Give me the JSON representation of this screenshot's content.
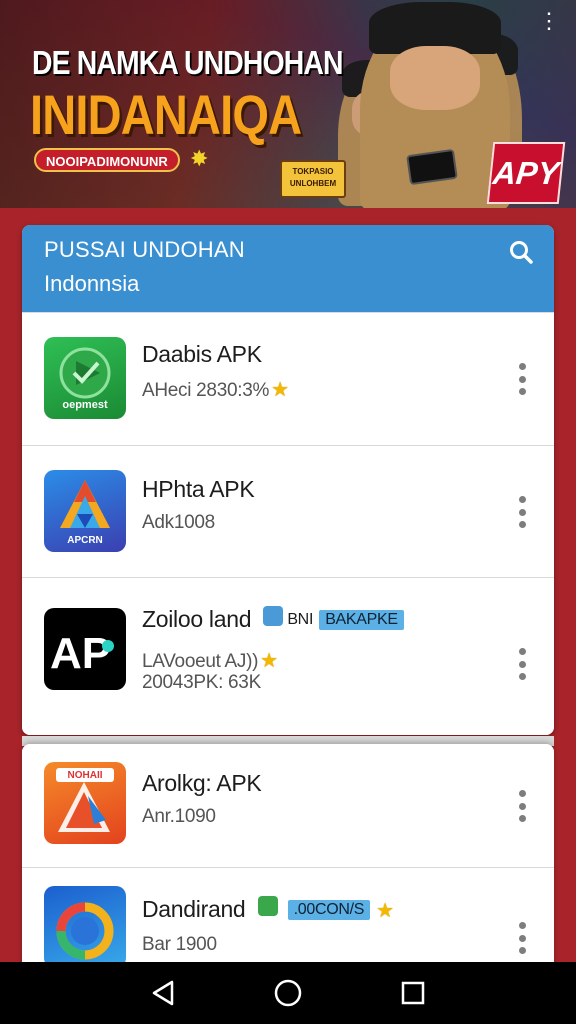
{
  "banner": {
    "line1": "DE NAMKA UNDHOHAN",
    "line2": "INIDANAIQA",
    "badge": "NOOIPADIMONUNR",
    "sign": "TOKPASIO UNLOHBEM",
    "apk_badge": "APY",
    "menu": "⋮"
  },
  "header": {
    "title": "PUSSAI UNDOHAN",
    "subtitle": "Indonnsia",
    "search_icon": "search-icon"
  },
  "apps": [
    {
      "name": "Daabis APK",
      "meta": "AHeci 2830:3%",
      "rating_star": true,
      "icon_label": "oepmest",
      "icon": "play-check-icon",
      "colors": [
        "#2db24a",
        "#1f8a36"
      ]
    },
    {
      "name": "HPhta APK",
      "meta": "Adk1008",
      "rating_star": false,
      "icon_label": "APCRN",
      "icon": "triangle-a-icon",
      "colors": [
        "#1e6fd9",
        "#2f4ab5"
      ]
    },
    {
      "name": "Zoiloo land",
      "tag": "BAKAPKE",
      "tag_prefix": "BNI",
      "meta": "LAVooeut AJ))",
      "meta2": "20043PK: 63K",
      "rating_star": true,
      "icon_label": "AP",
      "icon": "ap-logo-icon",
      "colors": [
        "#000000",
        "#111111"
      ]
    },
    {
      "name": "Arolkg: APK",
      "meta": "Anr.1090",
      "rating_star": false,
      "icon_label": "NOHAII",
      "icon": "orange-a-icon",
      "colors": [
        "#f07a22",
        "#e2431f"
      ]
    },
    {
      "name": "Dandirand",
      "tag": ".00CON/S",
      "meta": "Bar 1900",
      "rating_star": true,
      "icon_label": "",
      "icon": "ring-icon",
      "colors": [
        "#1c6fd2",
        "#35a7e8"
      ]
    }
  ],
  "navbar": {
    "back": "back-icon",
    "home": "home-icon",
    "recents": "recents-icon"
  },
  "colors": {
    "background": "#a8242a",
    "header": "#3a8fd0",
    "banner_orange": "#f7a21c",
    "star": "#f5b800"
  }
}
